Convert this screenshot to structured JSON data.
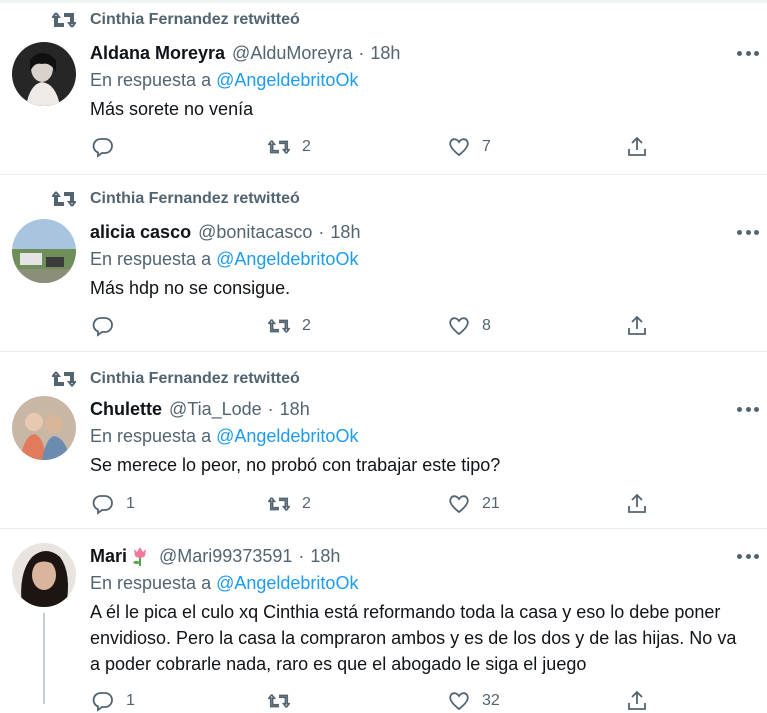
{
  "retweet_label": "Cinthia Fernandez retwitteó",
  "reply_prefix": "En respuesta a",
  "tweets": [
    {
      "name": "Aldana Moreyra",
      "handle": "@AlduMoreyra",
      "time": "18h",
      "reply_to": "@AngeldebritoOk",
      "text": "Más sorete no venía",
      "reply_count": "",
      "retweet_count": "2",
      "like_count": "7"
    },
    {
      "name": "alicia casco",
      "handle": "@bonitacasco",
      "time": "18h",
      "reply_to": "@AngeldebritoOk",
      "text": "Más hdp no se consigue.",
      "reply_count": "",
      "retweet_count": "2",
      "like_count": "8"
    },
    {
      "name": "Chulette",
      "handle": "@Tia_Lode",
      "time": "18h",
      "reply_to": "@AngeldebritoOk",
      "text": "Se merece lo peor, no probó con trabajar este tipo?",
      "reply_count": "1",
      "retweet_count": "2",
      "like_count": "21"
    },
    {
      "name": "Mari",
      "handle": "@Mari99373591",
      "time": "18h",
      "reply_to": "@AngeldebritoOk",
      "text": "A él le pica el culo xq Cinthia está reformando toda la casa y eso lo debe poner envidioso. Pero la casa la compraron ambos y es de los dos y de las hijas. No va a poder cobrarle nada, raro es que el abogado le siga el juego",
      "reply_count": "1",
      "retweet_count": "",
      "like_count": "32"
    }
  ],
  "colors": {
    "accent": "#1d9bf0",
    "muted": "#536471",
    "text": "#0f1419",
    "divider": "#e6ecf0"
  },
  "icons": {
    "retweet": "retweet-icon",
    "reply": "reply-icon",
    "like": "heart-icon",
    "share": "share-icon",
    "more": "more-icon",
    "name_emoji": "tulip-icon"
  }
}
